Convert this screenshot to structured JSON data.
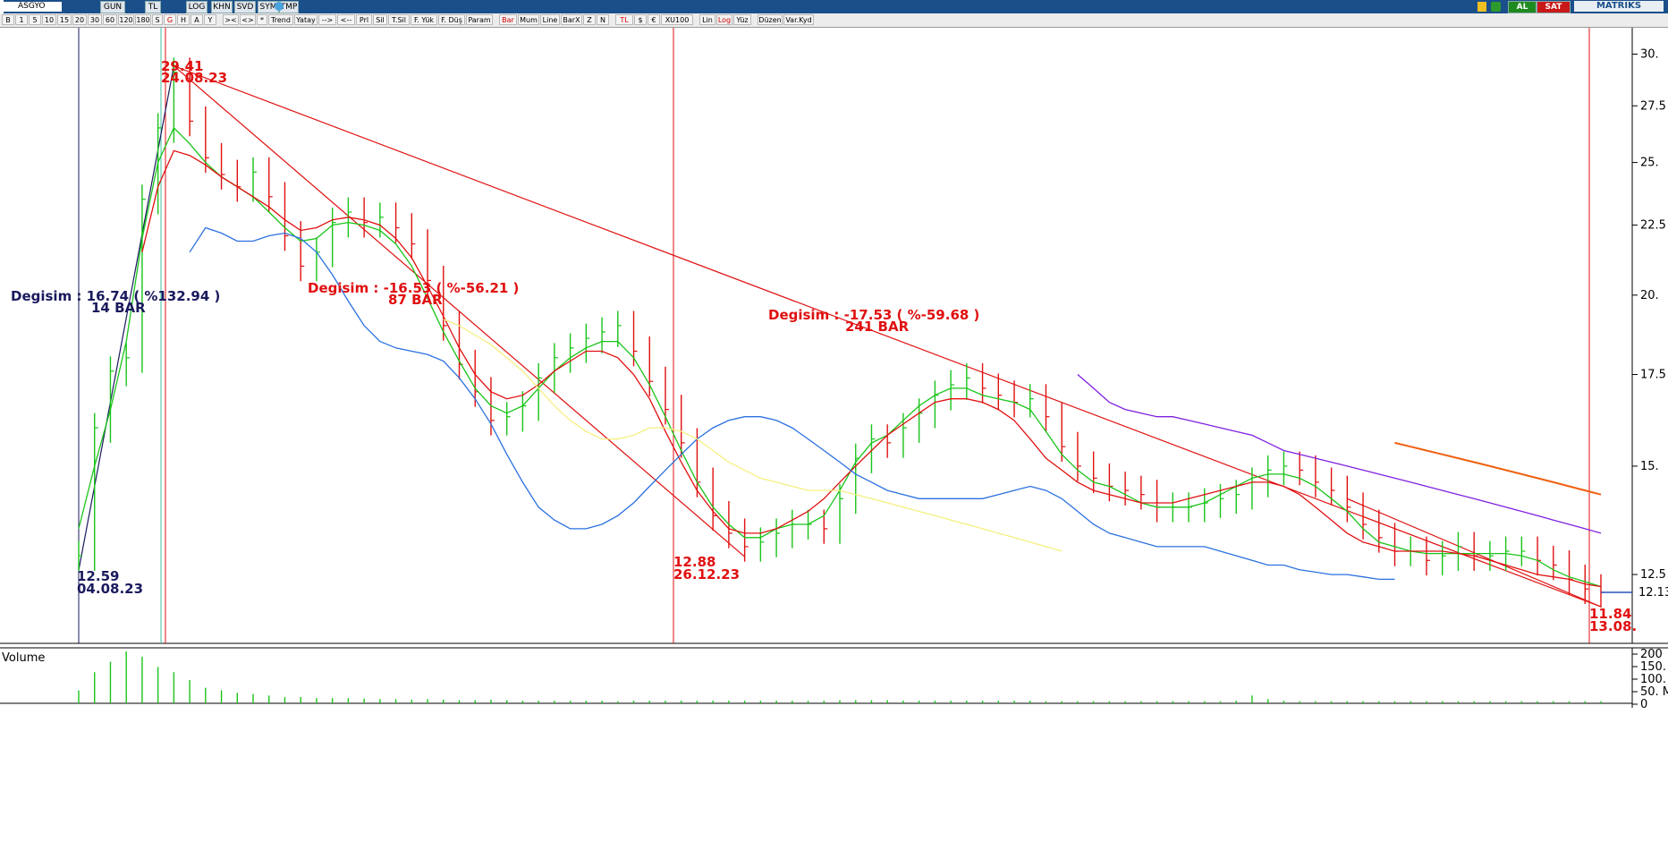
{
  "header": {
    "symbol": "ASGYO",
    "buy_label": "AL",
    "sell_label": "SAT",
    "brand": "MATRIKS"
  },
  "toolbar": [
    {
      "label": "B"
    },
    {
      "label": "1"
    },
    {
      "label": "5"
    },
    {
      "label": "10"
    },
    {
      "label": "15"
    },
    {
      "label": "20"
    },
    {
      "label": "30"
    },
    {
      "label": "60"
    },
    {
      "label": "120"
    },
    {
      "label": "180"
    },
    {
      "label": "S"
    },
    {
      "label": "G",
      "active": true
    },
    {
      "label": "H"
    },
    {
      "label": "A"
    },
    {
      "label": "Y"
    },
    {
      "label": "><"
    },
    {
      "label": "<>"
    },
    {
      "label": "*"
    },
    {
      "label": "Trend"
    },
    {
      "label": "Yatay"
    },
    {
      "label": "-->"
    },
    {
      "label": "<--"
    },
    {
      "label": "Prl"
    },
    {
      "label": "Sil"
    },
    {
      "label": "T.Sil"
    },
    {
      "label": "F. Yük"
    },
    {
      "label": "F. Düş"
    },
    {
      "label": "Param"
    },
    {
      "label": "Bar",
      "active": true
    },
    {
      "label": "Mum"
    },
    {
      "label": "Line"
    },
    {
      "label": "BarX"
    },
    {
      "label": "Z"
    },
    {
      "label": "N"
    },
    {
      "label": "TL",
      "active": true
    },
    {
      "label": "$"
    },
    {
      "label": "€"
    },
    {
      "label": "XU100"
    },
    {
      "label": "Lin"
    },
    {
      "label": "Log",
      "active": true
    },
    {
      "label": "Yüz"
    },
    {
      "label": "Düzen"
    },
    {
      "label": "Var.Kyd"
    }
  ],
  "toolbar_top": [
    {
      "label": "GUN"
    },
    {
      "label": "TL"
    },
    {
      "label": "LOG"
    },
    {
      "label": "KHN"
    },
    {
      "label": "SVD"
    },
    {
      "label": "SYM"
    },
    {
      "label": "TMP"
    }
  ],
  "chart_data": {
    "type": "bar",
    "scale": "log",
    "ylim": [
      11.2,
      30.8
    ],
    "y_ticks": [
      {
        "value": 30,
        "label": "30."
      },
      {
        "value": 27.5,
        "label": "27.5"
      },
      {
        "value": 25,
        "label": "25."
      },
      {
        "value": 22.5,
        "label": "22.5"
      },
      {
        "value": 20,
        "label": "20."
      },
      {
        "value": 17.5,
        "label": "17.5"
      },
      {
        "value": 15,
        "label": "15."
      },
      {
        "value": 12.5,
        "label": "12.5"
      }
    ],
    "last_price": {
      "value": 12.13,
      "label": "12.13"
    },
    "series_close": [
      12.9,
      16.0,
      17.6,
      18.0,
      23.5,
      26.5,
      29.1,
      26.8,
      25.2,
      24.5,
      24.0,
      24.6,
      23.6,
      22.1,
      21.0,
      21.5,
      22.6,
      23.0,
      22.6,
      22.8,
      22.4,
      21.8,
      20.5,
      19.0,
      17.8,
      17.0,
      16.2,
      16.3,
      16.6,
      17.4,
      18.0,
      18.3,
      18.6,
      18.8,
      19.0,
      18.2,
      17.3,
      16.5,
      15.6,
      14.6,
      13.8,
      13.4,
      13.1,
      13.2,
      13.4,
      13.6,
      13.6,
      13.5,
      14.2,
      15.2,
      15.7,
      15.6,
      16.0,
      16.4,
      16.9,
      17.2,
      17.4,
      17.1,
      16.9,
      16.7,
      16.8,
      16.3,
      15.5,
      15.0,
      14.7,
      14.5,
      14.4,
      14.3,
      14.0,
      14.0,
      14.0,
      14.1,
      14.2,
      14.3,
      14.6,
      14.9,
      15.0,
      14.9,
      14.6,
      14.4,
      14.0,
      13.6,
      13.3,
      13.0,
      13.0,
      12.8,
      12.9,
      13.1,
      12.9,
      12.9,
      13.0,
      13.0,
      12.8,
      12.7,
      12.4,
      12.2,
      12.13
    ],
    "moving_averages": [
      {
        "name": "MA-short",
        "color": "#19c419",
        "values": [
          13.5,
          15.0,
          16.5,
          18.5,
          22.0,
          25.0,
          26.5,
          25.8,
          25.0,
          24.4,
          24.0,
          23.6,
          23.0,
          22.4,
          21.9,
          22.0,
          22.5,
          22.6,
          22.5,
          22.3,
          21.8,
          21.0,
          19.9,
          18.8,
          17.9,
          17.1,
          16.6,
          16.4,
          16.6,
          17.1,
          17.6,
          18.0,
          18.3,
          18.5,
          18.5,
          18.0,
          17.2,
          16.3,
          15.4,
          14.6,
          14.0,
          13.6,
          13.3,
          13.3,
          13.5,
          13.6,
          13.6,
          13.8,
          14.4,
          15.1,
          15.6,
          15.8,
          16.2,
          16.6,
          16.9,
          17.1,
          17.1,
          16.9,
          16.8,
          16.7,
          16.5,
          15.9,
          15.3,
          14.9,
          14.6,
          14.5,
          14.3,
          14.1,
          14.0,
          14.0,
          14.0,
          14.1,
          14.3,
          14.5,
          14.7,
          14.8,
          14.8,
          14.7,
          14.5,
          14.2,
          13.9,
          13.5,
          13.2,
          13.1,
          13.0,
          12.95,
          12.95,
          12.95,
          12.95,
          12.95,
          12.95,
          12.9,
          12.8,
          12.6,
          12.45,
          12.35,
          12.25
        ]
      },
      {
        "name": "MA-mid",
        "color": "#e01010",
        "values": [
          null,
          null,
          null,
          null,
          21.5,
          24.0,
          25.5,
          25.3,
          24.9,
          24.4,
          24.0,
          23.6,
          23.2,
          22.7,
          22.3,
          22.4,
          22.7,
          22.8,
          22.7,
          22.5,
          22.0,
          21.3,
          20.3,
          19.3,
          18.3,
          17.5,
          17.0,
          16.8,
          16.9,
          17.2,
          17.6,
          17.9,
          18.2,
          18.2,
          18.0,
          17.5,
          16.8,
          15.9,
          15.1,
          14.4,
          13.9,
          13.5,
          13.4,
          13.4,
          13.5,
          13.7,
          13.9,
          14.2,
          14.6,
          15.0,
          15.4,
          15.8,
          16.1,
          16.4,
          16.7,
          16.8,
          16.8,
          16.7,
          16.5,
          16.2,
          15.7,
          15.2,
          14.9,
          14.6,
          14.4,
          14.3,
          14.2,
          14.1,
          14.1,
          14.1,
          14.2,
          14.3,
          14.4,
          14.5,
          14.6,
          14.6,
          14.5,
          14.3,
          14.0,
          13.7,
          13.4,
          13.2,
          13.1,
          13.0,
          13.0,
          13.0,
          13.0,
          12.95,
          12.9,
          12.8,
          12.7,
          12.6,
          12.5,
          12.45,
          12.4,
          12.3,
          12.25
        ]
      },
      {
        "name": "MA-long",
        "color": "#2a70e0",
        "values": [
          null,
          null,
          null,
          null,
          null,
          null,
          null,
          21.5,
          22.4,
          22.2,
          21.9,
          21.9,
          22.1,
          22.2,
          22.0,
          21.5,
          20.7,
          19.8,
          19.0,
          18.5,
          18.3,
          18.2,
          18.1,
          17.9,
          17.4,
          16.8,
          16.1,
          15.3,
          14.6,
          14.0,
          13.7,
          13.5,
          13.5,
          13.6,
          13.8,
          14.1,
          14.5,
          14.9,
          15.3,
          15.7,
          16.0,
          16.2,
          16.3,
          16.3,
          16.2,
          16.0,
          15.7,
          15.4,
          15.1,
          14.8,
          14.6,
          14.4,
          14.3,
          14.2,
          14.2,
          14.2,
          14.2,
          14.2,
          14.3,
          14.4,
          14.5,
          14.4,
          14.2,
          13.9,
          13.6,
          13.4,
          13.3,
          13.2,
          13.1,
          13.1,
          13.1,
          13.1,
          13.0,
          12.9,
          12.8,
          12.7,
          12.7,
          12.6,
          12.55,
          12.5,
          12.5,
          12.45,
          12.4,
          12.4
        ]
      },
      {
        "name": "MA-100",
        "color": "#f5f080",
        "values": [
          null,
          null,
          null,
          null,
          null,
          null,
          null,
          null,
          null,
          null,
          null,
          null,
          null,
          null,
          null,
          null,
          null,
          null,
          null,
          null,
          null,
          null,
          null,
          19.2,
          19.0,
          18.7,
          18.4,
          18.0,
          17.6,
          17.1,
          16.6,
          16.2,
          15.9,
          15.7,
          15.7,
          15.8,
          16.0,
          16.0,
          15.9,
          15.7,
          15.4,
          15.1,
          14.9,
          14.7,
          14.6,
          14.5,
          14.4,
          14.4,
          14.4,
          14.3,
          14.2,
          14.1,
          14.0,
          13.9,
          13.8,
          13.7,
          13.6,
          13.5,
          13.4,
          13.3,
          13.2,
          13.1,
          13.0
        ]
      },
      {
        "name": "MA-150",
        "color": "#8020e0",
        "values": [
          17.5,
          17.1,
          16.7,
          16.5,
          16.4,
          16.3,
          16.3,
          16.2,
          16.1,
          16.0,
          15.9,
          15.8,
          15.6,
          15.4,
          15.3,
          15.2,
          15.1,
          15.0,
          14.9,
          14.8,
          14.7,
          14.6,
          14.5,
          14.4,
          14.3,
          14.2,
          14.1,
          14.0,
          13.9,
          13.8,
          13.7,
          13.6,
          13.5,
          13.4
        ]
      },
      {
        "name": "MA-200",
        "color": "#f06010",
        "values": [
          15.6,
          15.5,
          15.4,
          15.3,
          15.2,
          15.1,
          15.0,
          14.9,
          14.8,
          14.7,
          14.6,
          14.5,
          14.4,
          14.3,
          14.2
        ]
      }
    ],
    "volume_axis": [
      "200",
      "150.",
      "100.",
      "50. M",
      "0"
    ],
    "volume_label": "Volume",
    "annotations": {
      "rally_change": "Degisim : 16.74 ( %132.94 )",
      "rally_bars": "14 BAR",
      "drop1_change": "Degisim : -16.53 ( %-56.21 )",
      "drop1_bars": "87 BAR",
      "drop2_change": "Degisim : -17.53 ( %-59.68 )",
      "drop2_bars": "241 BAR",
      "low1_price": "12.59",
      "low1_date": "04.08.23",
      "peak_price": "29.41",
      "peak_date": "24.08.23",
      "low2_price": "12.88",
      "low2_date": "26.12.23",
      "low3_price": "11.84",
      "low3_date": "13.08."
    }
  }
}
